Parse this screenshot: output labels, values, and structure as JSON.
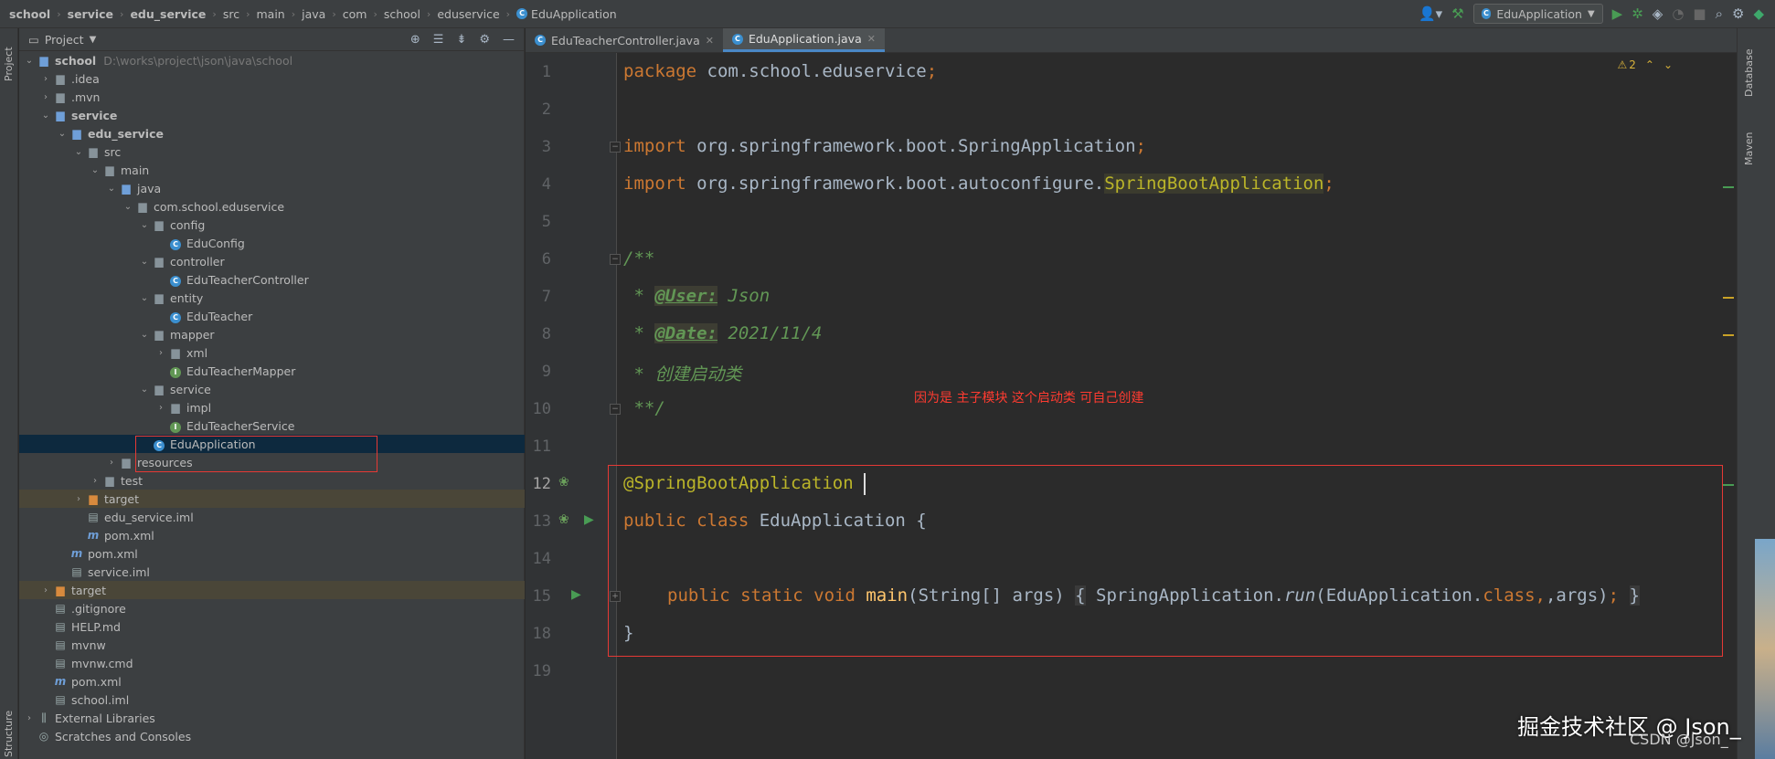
{
  "breadcrumb": [
    "school",
    "service",
    "edu_service",
    "src",
    "main",
    "java",
    "com",
    "school",
    "eduservice",
    "EduApplication"
  ],
  "toolbar": {
    "run_config": "EduApplication"
  },
  "left_stripe": {
    "project_label": "Project",
    "structure_label": "Structure"
  },
  "project_panel": {
    "title": "Project",
    "tree": [
      {
        "label": "school",
        "path": "D:\\works\\project\\json\\java\\school",
        "type": "module-folder",
        "arrow": "▾",
        "level": 0,
        "bold": true
      },
      {
        "label": ".idea",
        "type": "folder",
        "arrow": "›",
        "level": 1
      },
      {
        "label": ".mvn",
        "type": "folder",
        "arrow": "›",
        "level": 1
      },
      {
        "label": "service",
        "type": "module-folder",
        "arrow": "▾",
        "level": 1,
        "bold": true
      },
      {
        "label": "edu_service",
        "type": "module-folder",
        "arrow": "▾",
        "level": 2,
        "bold": true
      },
      {
        "label": "src",
        "type": "folder",
        "arrow": "▾",
        "level": 3
      },
      {
        "label": "main",
        "type": "folder",
        "arrow": "▾",
        "level": 4
      },
      {
        "label": "java",
        "type": "src-folder",
        "arrow": "▾",
        "level": 5
      },
      {
        "label": "com.school.eduservice",
        "type": "folder",
        "arrow": "▾",
        "level": 6
      },
      {
        "label": "config",
        "type": "folder",
        "arrow": "▾",
        "level": 7
      },
      {
        "label": "EduConfig",
        "type": "class",
        "arrow": "",
        "level": 8
      },
      {
        "label": "controller",
        "type": "folder",
        "arrow": "▾",
        "level": 7
      },
      {
        "label": "EduTeacherController",
        "type": "class",
        "arrow": "",
        "level": 8
      },
      {
        "label": "entity",
        "type": "folder",
        "arrow": "▾",
        "level": 7
      },
      {
        "label": "EduTeacher",
        "type": "class",
        "arrow": "",
        "level": 8
      },
      {
        "label": "mapper",
        "type": "folder",
        "arrow": "▾",
        "level": 7
      },
      {
        "label": "xml",
        "type": "folder",
        "arrow": "›",
        "level": 8
      },
      {
        "label": "EduTeacherMapper",
        "type": "interface",
        "arrow": "",
        "level": 8
      },
      {
        "label": "service",
        "type": "folder",
        "arrow": "▾",
        "level": 7
      },
      {
        "label": "impl",
        "type": "folder",
        "arrow": "›",
        "level": 8
      },
      {
        "label": "EduTeacherService",
        "type": "interface",
        "arrow": "",
        "level": 8
      },
      {
        "label": "EduApplication",
        "type": "spring-class",
        "arrow": "",
        "level": 7,
        "selected": true
      },
      {
        "label": "resources",
        "type": "res-folder",
        "arrow": "›",
        "level": 5
      },
      {
        "label": "test",
        "type": "folder",
        "arrow": "›",
        "level": 4
      },
      {
        "label": "target",
        "type": "excluded",
        "arrow": "›",
        "level": 3,
        "excluded": true
      },
      {
        "label": "edu_service.iml",
        "type": "iml",
        "arrow": "",
        "level": 3
      },
      {
        "label": "pom.xml",
        "type": "maven",
        "arrow": "",
        "level": 3
      },
      {
        "label": "pom.xml",
        "type": "maven",
        "arrow": "",
        "level": 2
      },
      {
        "label": "service.iml",
        "type": "iml",
        "arrow": "",
        "level": 2
      },
      {
        "label": "target",
        "type": "excluded",
        "arrow": "›",
        "level": 1,
        "excluded": true
      },
      {
        "label": ".gitignore",
        "type": "file",
        "arrow": "",
        "level": 1
      },
      {
        "label": "HELP.md",
        "type": "file",
        "arrow": "",
        "level": 1
      },
      {
        "label": "mvnw",
        "type": "file",
        "arrow": "",
        "level": 1
      },
      {
        "label": "mvnw.cmd",
        "type": "file",
        "arrow": "",
        "level": 1
      },
      {
        "label": "pom.xml",
        "type": "maven",
        "arrow": "",
        "level": 1
      },
      {
        "label": "school.iml",
        "type": "iml",
        "arrow": "",
        "level": 1
      },
      {
        "label": "External Libraries",
        "type": "libs",
        "arrow": "›",
        "level": 0
      },
      {
        "label": "Scratches and Consoles",
        "type": "scratch",
        "arrow": "",
        "level": 0
      }
    ]
  },
  "editor": {
    "tabs": [
      {
        "label": "EduTeacherController.java",
        "active": false
      },
      {
        "label": "EduApplication.java",
        "active": true
      }
    ],
    "warning_count": "2",
    "line_numbers": [
      "1",
      "2",
      "3",
      "4",
      "5",
      "6",
      "7",
      "8",
      "9",
      "10",
      "11",
      "12",
      "13",
      "14",
      "15",
      "18",
      "19"
    ],
    "code": {
      "l1_kw": "package",
      "l1_rest": " com.school.eduservice",
      "l3_kw": "import",
      "l3_rest": " org.springframework.boot.SpringApplication",
      "l4_kw": "import",
      "l4_rest": " org.springframework.boot.autoconfigure.",
      "l4_hl": "SpringBootApplication",
      "semi": ";",
      "l6": "/**",
      "l7_star": " * ",
      "l7_tag": "@User:",
      "l7_val": " Json",
      "l8_star": " * ",
      "l8_tag": "@Date:",
      "l8_val": " 2021/11/4",
      "l9": " * 创建启动类",
      "l10": " **/",
      "l12": "@SpringBootApplication",
      "l13_kw": "public class",
      "l13_rest": " EduApplication {",
      "l15_kw": "public static void",
      "l15_fn": "main",
      "l15_a": "(String[] args) ",
      "l15_b1": "{",
      "l15_c": " SpringApplication.",
      "l15_run": "run",
      "l15_d": "(EduApplication.",
      "l15_cls": "class",
      "l15_e": ",args)",
      "l15_b2": "}",
      "l18": "}"
    },
    "note": "因为是 主子模块 这个启动类 可自己创建"
  },
  "right_stripe": {
    "database_label": "Database",
    "maven_label": "Maven"
  },
  "watermark": {
    "main": "掘金技术社区 @ Json_",
    "sub": "CSDN @Json_"
  },
  "colors": {
    "keyword": "#cc7832",
    "annotation": "#bbb529",
    "comment": "#629755",
    "function": "#ffc66d",
    "highlight_box": "#e53935"
  }
}
